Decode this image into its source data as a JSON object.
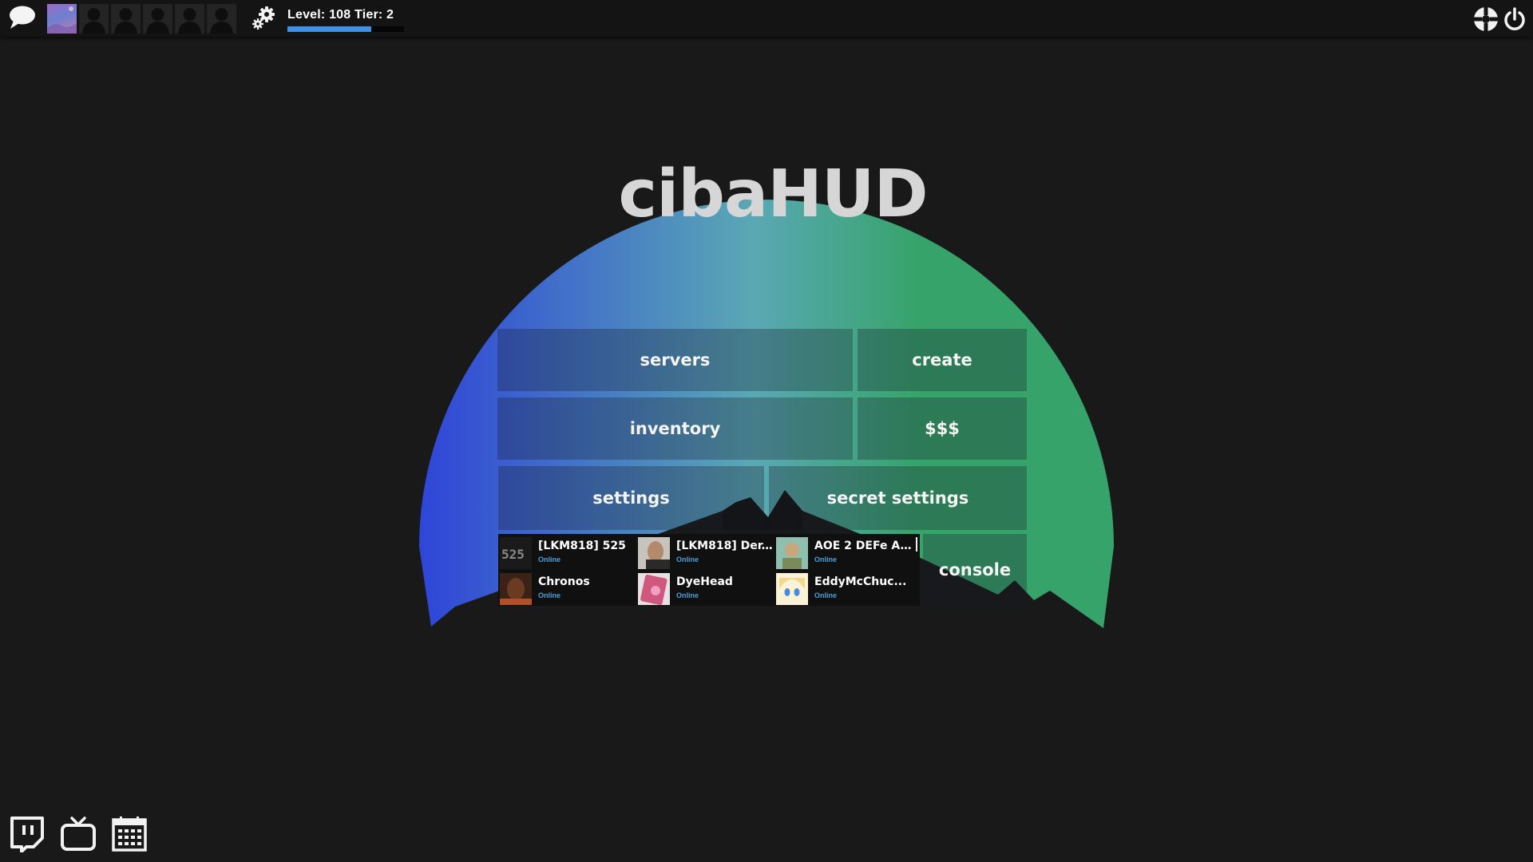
{
  "topbar": {
    "level_text": "Level: 108 Tier: 2",
    "level_progress": 0.72,
    "icons": {
      "chat": "chat-bubble-icon",
      "settings": "gears-icon",
      "tf2": "tf2-logo-icon",
      "power": "power-icon"
    },
    "party_slots": [
      "current-user-avatar",
      "empty",
      "empty",
      "empty",
      "empty",
      "empty"
    ]
  },
  "hud": {
    "title": "cibaHUD",
    "accent_left": "#2f45d8",
    "accent_mid": "#5aa8b5",
    "accent_right": "#36a46a"
  },
  "menu": {
    "servers": "servers",
    "create": "create",
    "inventory": "inventory",
    "money": "$$$",
    "settings": "settings",
    "secret_settings": "secret settings",
    "console": "console"
  },
  "friends": [
    {
      "name": "[LKM818] 525",
      "status": "Online"
    },
    {
      "name": "[LKM818] Der...",
      "status": "Online"
    },
    {
      "name": "AOE 2 DEFe A...",
      "status": "Online"
    },
    {
      "name": "Chronos",
      "status": "Online"
    },
    {
      "name": "DyeHead",
      "status": "Online"
    },
    {
      "name": "EddyMcChuc...",
      "status": "Online"
    }
  ],
  "bottom_icons": [
    "twitch-icon",
    "tv-icon",
    "calendar-icon"
  ]
}
